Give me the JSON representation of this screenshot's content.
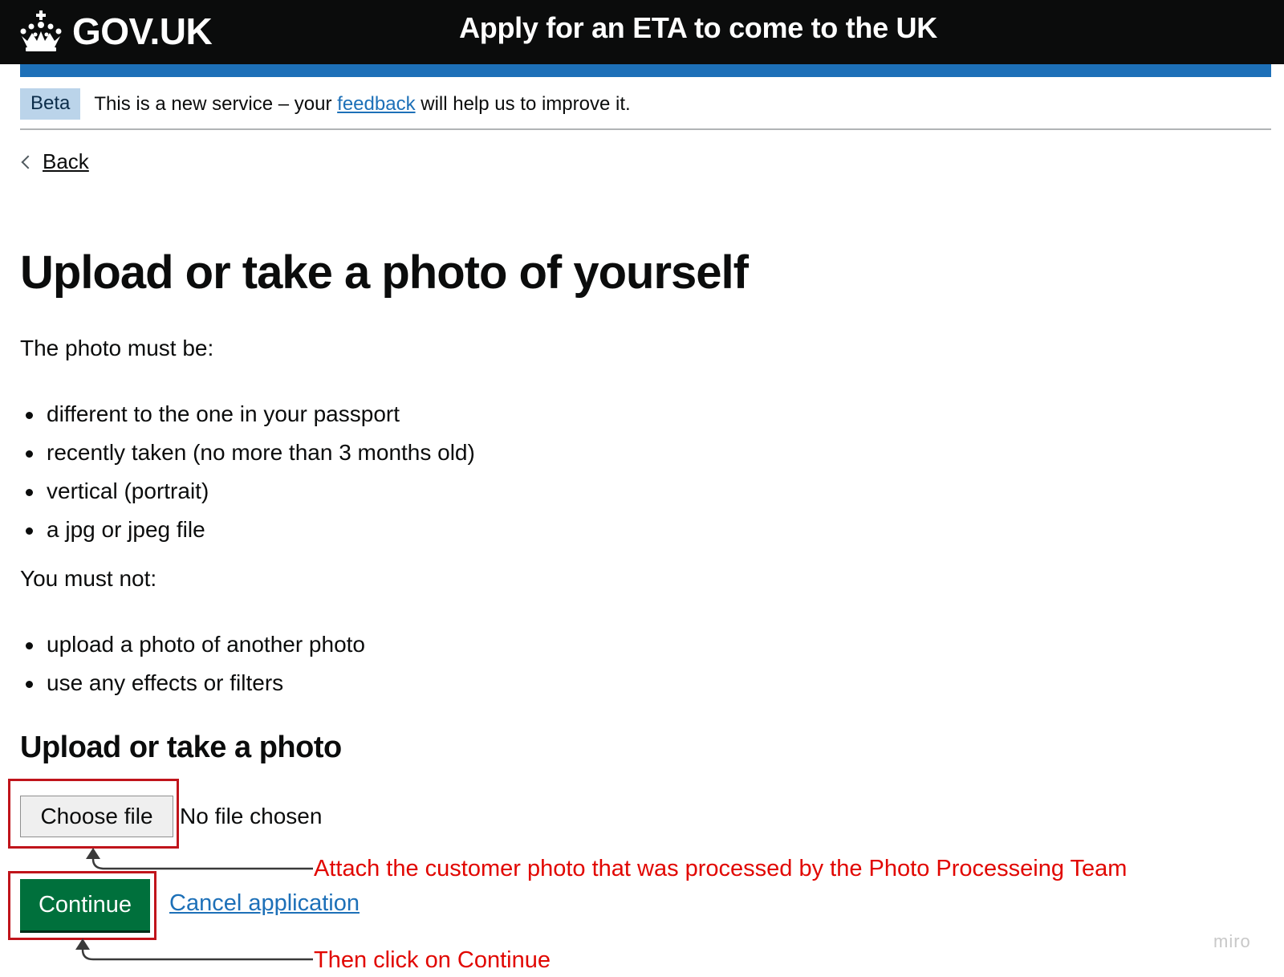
{
  "header": {
    "logo_text": "GOV.UK",
    "service_name": "Apply for an ETA to come to the UK"
  },
  "phase_banner": {
    "tag": "Beta",
    "text_before": "This is a new service – your ",
    "link": "feedback",
    "text_after": " will help us to improve it."
  },
  "back_link": "Back",
  "main": {
    "title": "Upload or take a photo of yourself",
    "intro": "The photo must be:",
    "must_be": [
      "different to the one in your passport",
      "recently taken (no more than 3 months old)",
      "vertical (portrait)",
      "a jpg or jpeg file"
    ],
    "must_not_intro": "You must not:",
    "must_not": [
      "upload a photo of another photo",
      "use any effects or filters"
    ],
    "upload_heading": "Upload or take a photo",
    "choose_file_label": "Choose file",
    "file_status": "No file chosen",
    "continue_label": "Continue",
    "cancel_label": "Cancel application"
  },
  "annotations": {
    "attach_note": "Attach the customer photo that was processed by the Photo Processeing Team",
    "continue_note": "Then click on Continue",
    "color": "#e10600"
  },
  "watermark": "miro",
  "colors": {
    "header_bg": "#0b0c0c",
    "brand_blue": "#1d70b8",
    "button_green": "#00703c",
    "tag_bg": "#bbd4ea"
  }
}
